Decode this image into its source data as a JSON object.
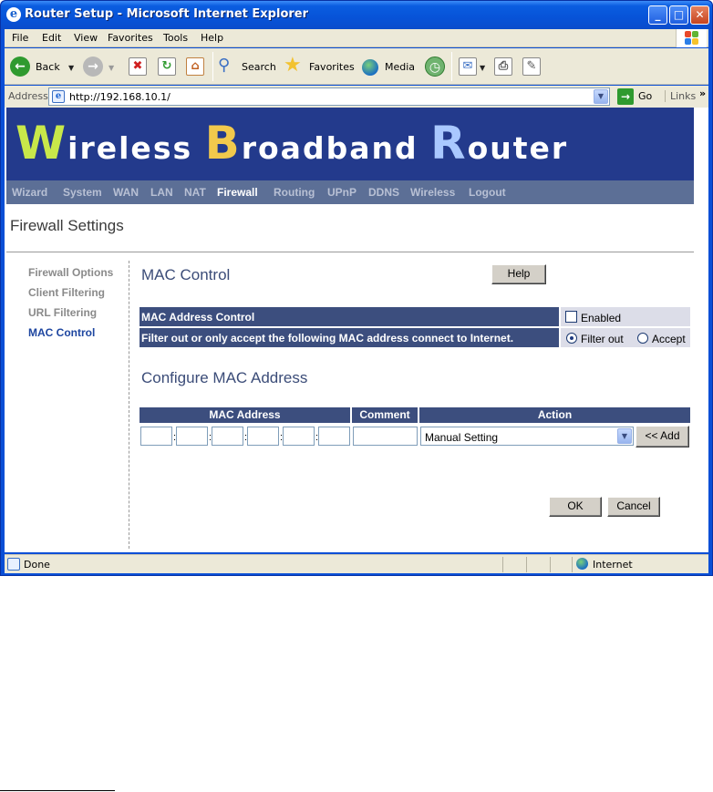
{
  "window": {
    "title": "Router Setup - Microsoft Internet Explorer"
  },
  "menu": [
    "File",
    "Edit",
    "View",
    "Favorites",
    "Tools",
    "Help"
  ],
  "toolbar": {
    "back": "Back",
    "search": "Search",
    "favorites": "Favorites",
    "media": "Media"
  },
  "address": {
    "label": "Address",
    "url": "http://192.168.10.1/",
    "go": "Go",
    "links": "Links",
    "chevron": "»"
  },
  "banner": {
    "words": [
      {
        "cap": "W",
        "rest": "ireless",
        "cap_color": "#c8e84a"
      },
      {
        "cap": "B",
        "rest": "roadband",
        "cap_color": "#f2c94c"
      },
      {
        "cap": "R",
        "rest": "outer",
        "cap_color": "#a9c8ff"
      }
    ]
  },
  "nav": [
    "Wizard",
    "System",
    "WAN",
    "LAN",
    "NAT",
    "Firewall",
    "Routing",
    "UPnP",
    "DDNS",
    "Wireless",
    "Logout"
  ],
  "nav_active": "Firewall",
  "page_title": "Firewall Settings",
  "sidebar": [
    "Firewall Options",
    "Client Filtering",
    "URL Filtering",
    "MAC Control"
  ],
  "sidebar_active": "MAC Control",
  "mac_control": {
    "title": "MAC Control",
    "help": "Help",
    "row1_label": "MAC Address Control",
    "enabled_label": "Enabled",
    "enabled_checked": false,
    "row2_label": "Filter out or only accept  the following MAC address  connect to Internet.",
    "filter_out": "Filter out",
    "accept": "Accept",
    "selected_mode": "Filter out"
  },
  "configure": {
    "title": "Configure MAC Address",
    "col_mac": "MAC Address",
    "col_comment": "Comment",
    "col_action": "Action",
    "colon": ":",
    "select_value": "Manual Setting",
    "add": "<< Add"
  },
  "buttons": {
    "ok": "OK",
    "cancel": "Cancel"
  },
  "status": {
    "left": "Done",
    "zone": "Internet"
  },
  "colors": {
    "title_bar": "#0753d8",
    "banner": "#233a8c",
    "nav_bar": "#5c6f96",
    "table_header": "#3c4e7e",
    "accent_text": "#1e46a0"
  }
}
